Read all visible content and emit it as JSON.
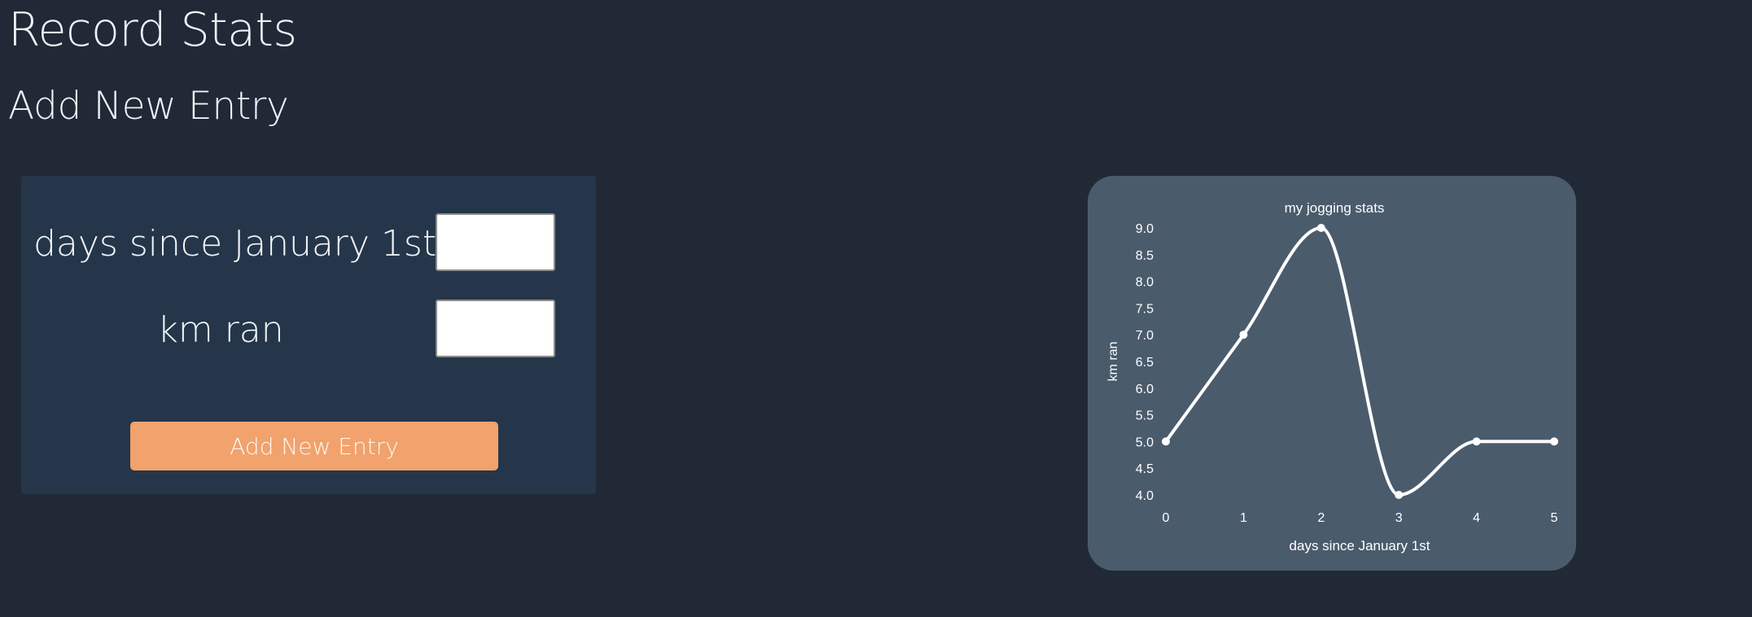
{
  "page": {
    "title": "Record Stats",
    "section_title": "Add New Entry"
  },
  "form": {
    "days_label": "days since January 1st",
    "km_label": "km ran",
    "days_value": "",
    "km_value": "",
    "submit_label": "Add New Entry"
  },
  "colors": {
    "background": "#202935",
    "form_panel": "#25364a",
    "button": "#f1a26d",
    "chart_card": "#4a5b6c",
    "line": "#ffffff"
  },
  "chart_data": {
    "type": "line",
    "title": "my jogging stats",
    "xlabel": "days since January 1st",
    "ylabel": "km ran",
    "x": [
      0,
      1,
      2,
      3,
      4,
      5
    ],
    "series": [
      {
        "values": [
          5.0,
          7.0,
          9.0,
          4.0,
          5.0,
          5.0
        ]
      }
    ],
    "xlim": [
      0,
      5
    ],
    "ylim": [
      4.0,
      9.0
    ],
    "xticks": [
      "0",
      "1",
      "2",
      "3",
      "4",
      "5"
    ],
    "yticks": [
      "4.0",
      "4.5",
      "5.0",
      "5.5",
      "6.0",
      "6.5",
      "7.0",
      "7.5",
      "8.0",
      "8.5",
      "9.0"
    ],
    "grid": false,
    "smooth": true,
    "markers": true
  }
}
